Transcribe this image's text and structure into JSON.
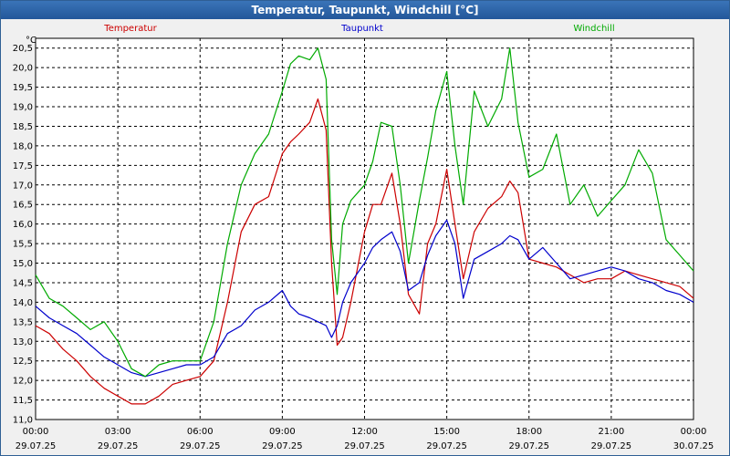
{
  "window": {
    "title": "Temperatur, Taupunkt, Windchill [°C]"
  },
  "chart_data": {
    "type": "line",
    "title": "Temperatur, Taupunkt, Windchill [°C]",
    "ylabel": "°C",
    "ylim": [
      11.0,
      20.75
    ],
    "xlim": [
      0,
      24
    ],
    "grid": true,
    "legend_placement": "top",
    "y_ticks": [
      "11,0",
      "11,5",
      "12,0",
      "12,5",
      "13,0",
      "13,5",
      "14,0",
      "14,5",
      "15,0",
      "15,5",
      "16,0",
      "16,5",
      "17,0",
      "17,5",
      "18,0",
      "18,5",
      "19,0",
      "19,5",
      "20,0",
      "20,5"
    ],
    "x_ticks": [
      {
        "time": "00:00",
        "date": "29.07.25"
      },
      {
        "time": "03:00",
        "date": "29.07.25"
      },
      {
        "time": "06:00",
        "date": "29.07.25"
      },
      {
        "time": "09:00",
        "date": "29.07.25"
      },
      {
        "time": "12:00",
        "date": "29.07.25"
      },
      {
        "time": "15:00",
        "date": "29.07.25"
      },
      {
        "time": "18:00",
        "date": "29.07.25"
      },
      {
        "time": "21:00",
        "date": "29.07.25"
      },
      {
        "time": "00:00",
        "date": "30.07.25"
      }
    ],
    "series": [
      {
        "name": "Temperatur",
        "color": "#cc0000",
        "x": [
          0,
          0.5,
          1,
          1.5,
          2,
          2.5,
          3,
          3.5,
          4,
          4.5,
          5,
          5.5,
          6,
          6.5,
          7,
          7.5,
          8,
          8.5,
          9,
          9.3,
          9.6,
          10,
          10.3,
          10.6,
          10.8,
          11,
          11.2,
          11.5,
          12,
          12.3,
          12.6,
          13,
          13.3,
          13.6,
          14,
          14.3,
          14.6,
          15,
          15.3,
          15.6,
          16,
          16.5,
          17,
          17.3,
          17.6,
          18,
          18.5,
          19,
          19.5,
          20,
          20.5,
          21,
          21.5,
          22,
          22.5,
          23,
          23.5,
          24
        ],
        "y": [
          13.4,
          13.2,
          12.8,
          12.5,
          12.1,
          11.8,
          11.6,
          11.4,
          11.4,
          11.6,
          11.9,
          12.0,
          12.1,
          12.5,
          14.0,
          15.8,
          16.5,
          16.7,
          17.8,
          18.1,
          18.3,
          18.6,
          19.2,
          18.4,
          15.0,
          12.9,
          13.1,
          14.0,
          15.8,
          16.5,
          16.5,
          17.3,
          16.0,
          14.2,
          13.7,
          15.5,
          16.0,
          17.4,
          16.0,
          14.6,
          15.8,
          16.4,
          16.7,
          17.1,
          16.8,
          15.1,
          15.0,
          14.9,
          14.7,
          14.5,
          14.6,
          14.6,
          14.8,
          14.7,
          14.6,
          14.5,
          14.4,
          14.1
        ]
      },
      {
        "name": "Taupunkt",
        "color": "#0000cc",
        "x": [
          0,
          0.5,
          1,
          1.5,
          2,
          2.5,
          3,
          3.5,
          4,
          4.5,
          5,
          5.5,
          6,
          6.5,
          7,
          7.5,
          8,
          8.5,
          9,
          9.3,
          9.6,
          10,
          10.3,
          10.6,
          10.8,
          11,
          11.2,
          11.5,
          12,
          12.3,
          12.6,
          13,
          13.3,
          13.6,
          14,
          14.3,
          14.6,
          15,
          15.3,
          15.6,
          16,
          16.5,
          17,
          17.3,
          17.6,
          18,
          18.5,
          19,
          19.5,
          20,
          20.5,
          21,
          21.5,
          22,
          22.5,
          23,
          23.5,
          24
        ],
        "y": [
          13.9,
          13.6,
          13.4,
          13.2,
          12.9,
          12.6,
          12.4,
          12.2,
          12.1,
          12.2,
          12.3,
          12.4,
          12.4,
          12.6,
          13.2,
          13.4,
          13.8,
          14.0,
          14.3,
          13.9,
          13.7,
          13.6,
          13.5,
          13.4,
          13.1,
          13.4,
          14.0,
          14.5,
          15.0,
          15.4,
          15.6,
          15.8,
          15.3,
          14.3,
          14.5,
          15.2,
          15.7,
          16.1,
          15.5,
          14.1,
          15.1,
          15.3,
          15.5,
          15.7,
          15.6,
          15.1,
          15.4,
          15.0,
          14.6,
          14.7,
          14.8,
          14.9,
          14.8,
          14.6,
          14.5,
          14.3,
          14.2,
          14.0
        ]
      },
      {
        "name": "Windchill",
        "color": "#00aa00",
        "x": [
          0,
          0.5,
          1,
          1.5,
          2,
          2.5,
          3,
          3.5,
          4,
          4.5,
          5,
          5.5,
          6,
          6.5,
          7,
          7.5,
          8,
          8.5,
          9,
          9.3,
          9.6,
          10,
          10.3,
          10.6,
          10.8,
          11,
          11.2,
          11.5,
          12,
          12.3,
          12.6,
          13,
          13.3,
          13.6,
          14,
          14.3,
          14.6,
          15,
          15.3,
          15.6,
          16,
          16.5,
          17,
          17.3,
          17.6,
          18,
          18.5,
          19,
          19.5,
          20,
          20.5,
          21,
          21.5,
          22,
          22.5,
          23,
          23.5,
          24
        ],
        "y": [
          14.7,
          14.1,
          13.9,
          13.6,
          13.3,
          13.5,
          13.0,
          12.3,
          12.1,
          12.4,
          12.5,
          12.5,
          12.5,
          13.5,
          15.5,
          17.0,
          17.8,
          18.3,
          19.4,
          20.1,
          20.3,
          20.2,
          20.5,
          19.7,
          15.6,
          14.2,
          16.0,
          16.6,
          17.0,
          17.6,
          18.6,
          18.5,
          17.0,
          15.0,
          16.6,
          17.7,
          18.9,
          19.9,
          18.0,
          16.5,
          19.4,
          18.5,
          19.2,
          20.5,
          18.6,
          17.2,
          17.4,
          18.3,
          16.5,
          17.0,
          16.2,
          16.6,
          17.0,
          17.9,
          17.3,
          15.6,
          15.2,
          14.8
        ]
      }
    ]
  }
}
